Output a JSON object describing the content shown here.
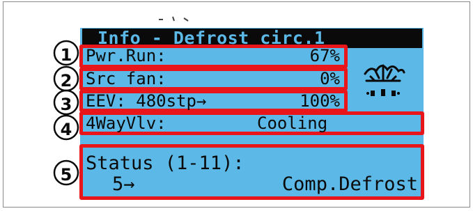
{
  "screen": {
    "title": "Info - Defrost circ.1",
    "rows": [
      {
        "label": "Pwr.Run:",
        "value": "67%"
      },
      {
        "label": "Src fan:",
        "value": "0%"
      },
      {
        "label": "EEV: 480stp→",
        "value": "100%"
      },
      {
        "label": "4WayVlv:",
        "value": "Cooling"
      }
    ],
    "status": {
      "label": "Status (1-11):",
      "code": "5→",
      "text": "Comp.Defrost"
    }
  },
  "callouts": [
    "1",
    "2",
    "3",
    "4",
    "5"
  ],
  "icons": {
    "defrost": "snowflake-defrost-icon"
  },
  "colors": {
    "lcd": "#5cb8e6",
    "highlight": "#e8161b",
    "ink": "#0a0a0a"
  }
}
